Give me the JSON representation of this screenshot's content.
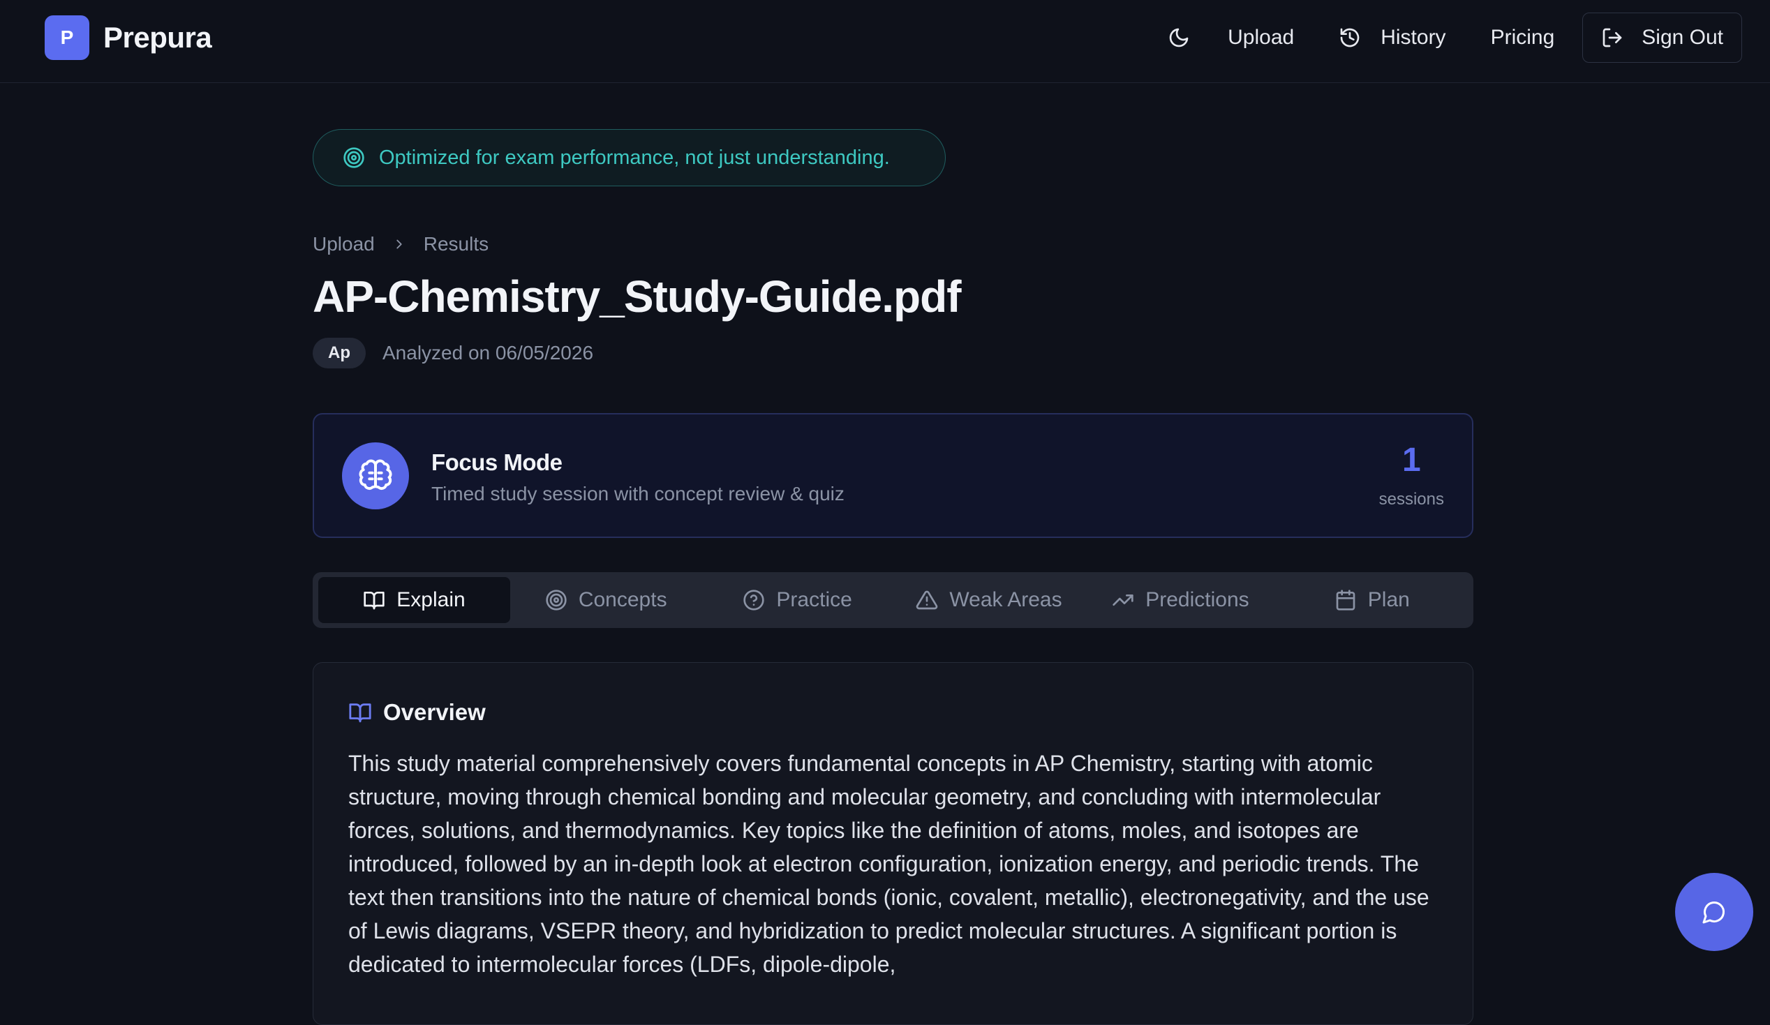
{
  "header": {
    "logo_letter": "P",
    "brand": "Prepura",
    "nav": {
      "theme_icon": "moon-icon",
      "upload": "Upload",
      "history": "History",
      "pricing": "Pricing",
      "sign_out": "Sign Out"
    }
  },
  "banner": {
    "text": "Optimized for exam performance, not just understanding.",
    "icon": "target-icon"
  },
  "breadcrumb": {
    "items": [
      "Upload",
      "Results"
    ]
  },
  "document": {
    "title": "AP-Chemistry_Study-Guide.pdf",
    "tag": "Ap",
    "analyzed": "Analyzed on 06/05/2026"
  },
  "focus_mode": {
    "title": "Focus Mode",
    "subtitle": "Timed study session with concept review & quiz",
    "count": "1",
    "count_label": "sessions"
  },
  "tabs": [
    {
      "label": "Explain",
      "icon": "book-icon",
      "active": true
    },
    {
      "label": "Concepts",
      "icon": "target-icon",
      "active": false
    },
    {
      "label": "Practice",
      "icon": "help-circle-icon",
      "active": false
    },
    {
      "label": "Weak Areas",
      "icon": "warning-icon",
      "active": false
    },
    {
      "label": "Predictions",
      "icon": "trending-up-icon",
      "active": false
    },
    {
      "label": "Plan",
      "icon": "calendar-icon",
      "active": false
    }
  ],
  "overview": {
    "heading": "Overview",
    "text": "This study material comprehensively covers fundamental concepts in AP Chemistry, starting with atomic structure, moving through chemical bonding and molecular geometry, and concluding with intermolecular forces, solutions, and thermodynamics. Key topics like the definition of atoms, moles, and isotopes are introduced, followed by an in-depth look at electron configuration, ionization energy, and periodic trends. The text then transitions into the nature of chemical bonds (ionic, covalent, metallic), electronegativity, and the use of Lewis diagrams, VSEPR theory, and hybridization to predict molecular structures. A significant portion is dedicated to intermolecular forces (LDFs, dipole-dipole,"
  },
  "colors": {
    "background": "#0e111a",
    "accent": "#5b6cf0",
    "banner_text": "#3ec9c2",
    "muted": "#8b93a5"
  }
}
